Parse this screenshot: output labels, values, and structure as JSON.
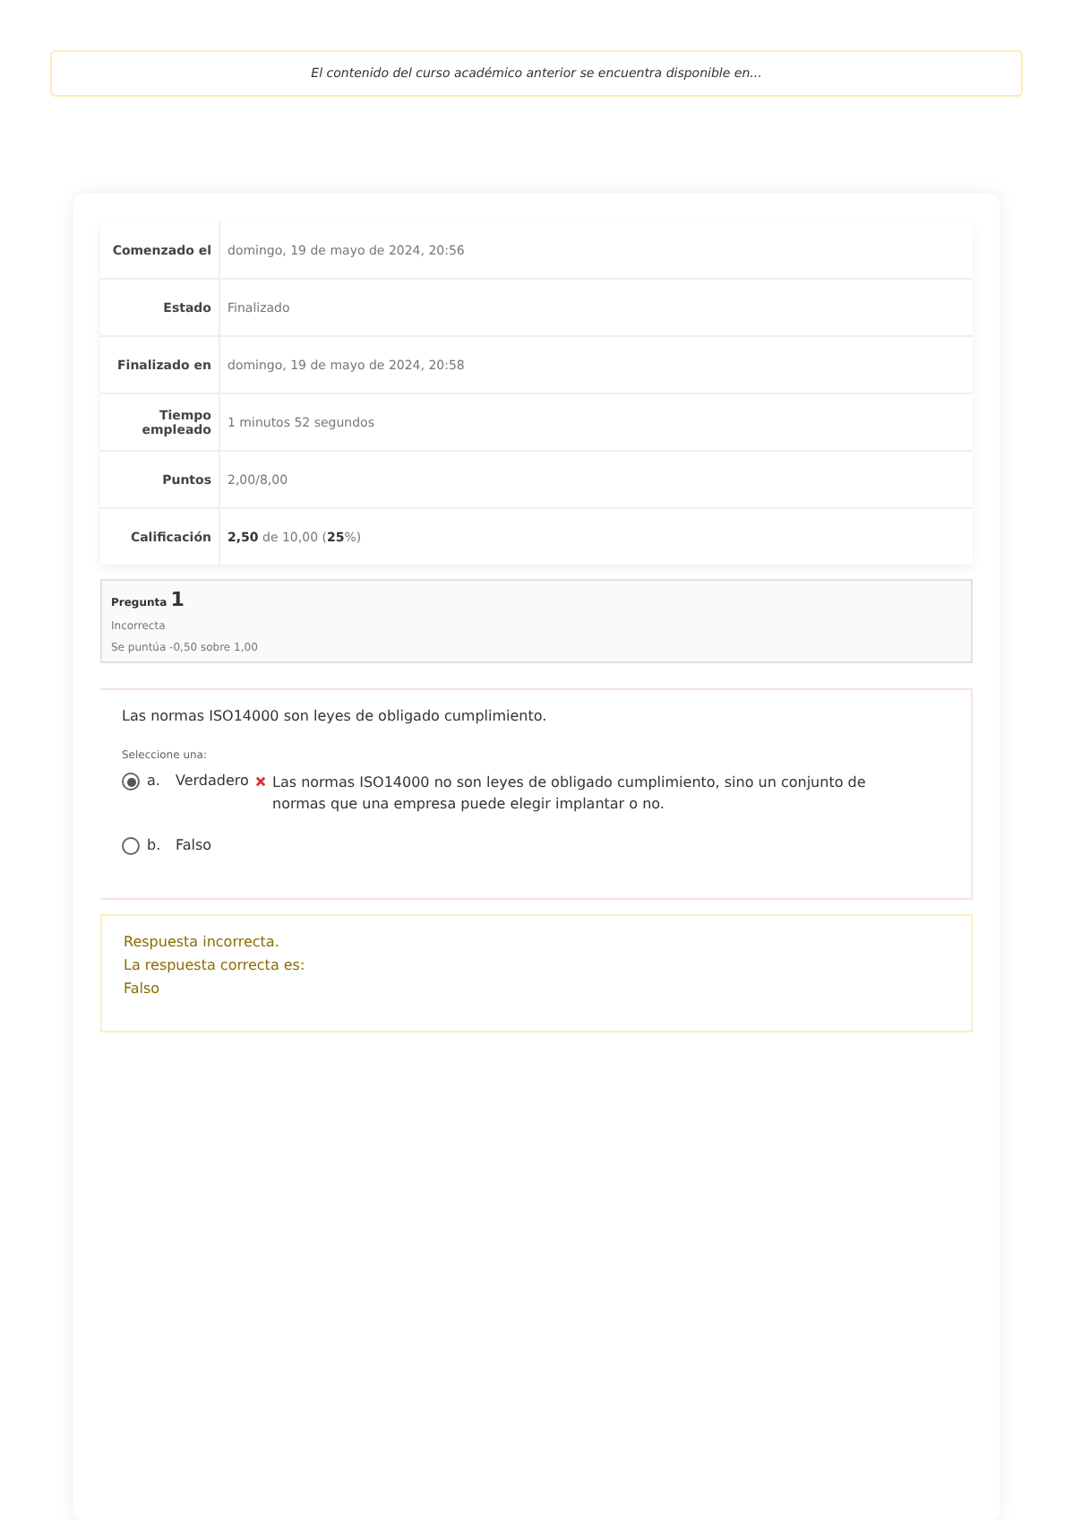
{
  "banner": {
    "text": "El contenido del curso académico anterior se encuentra disponible en..."
  },
  "summary": [
    {
      "label": "Comenzado el",
      "value": "domingo, 19 de mayo de 2024, 20:56"
    },
    {
      "label": "Estado",
      "value": "Finalizado"
    },
    {
      "label": "Finalizado en",
      "value": "domingo, 19 de mayo de 2024, 20:58"
    },
    {
      "label": "Tiempo empleado",
      "value": "1 minutos 52 segundos"
    },
    {
      "label": "Puntos",
      "value": "2,00/8,00"
    },
    {
      "label": "Calificación",
      "value": "**2,50** de 10,00 (**25**%)"
    }
  ],
  "question_info": {
    "label": "Pregunta",
    "number": "1",
    "state": "Incorrecta",
    "grade": "Se puntúa -0,50 sobre 1,00"
  },
  "question": {
    "text": "Las normas ISO14000 son leyes de obligado cumplimiento.",
    "prompt": "Seleccione una:",
    "options": [
      {
        "letter": "a.",
        "label": "Verdadero",
        "selected": true,
        "wrong": true,
        "feedback": "Las normas ISO14000 no son leyes de obligado cumplimiento, sino un conjunto de normas que una empresa puede elegir implantar o no."
      },
      {
        "letter": "b.",
        "label": "Falso",
        "selected": false,
        "wrong": false
      }
    ]
  },
  "feedback": {
    "verdict": "Respuesta incorrecta.",
    "correct_label": "La respuesta correcta es:",
    "correct_value": "Falso"
  }
}
